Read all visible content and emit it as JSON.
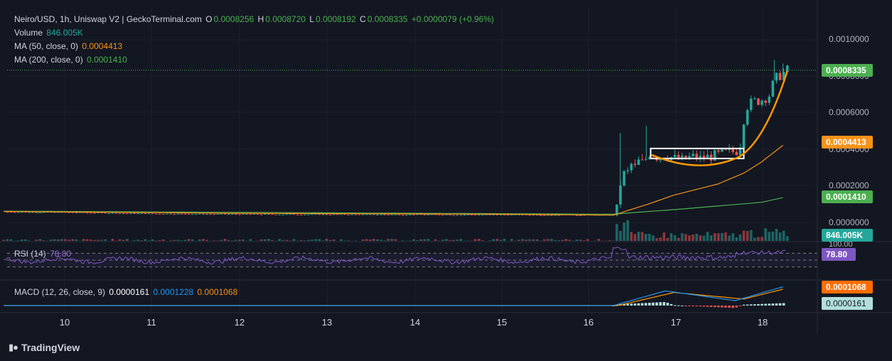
{
  "header": {
    "symbol_line": "Neiro/USD, 1h, Uniswap V2 | GeckoTerminal.com",
    "o_label": "O",
    "o_value": "0.0008256",
    "h_label": "H",
    "h_value": "0.0008720",
    "l_label": "L",
    "l_value": "0.0008192",
    "c_label": "C",
    "c_value": "0.0008335",
    "change": "+0.0000079 (+0.96%)"
  },
  "indicators": {
    "volume_label": "Volume",
    "volume_value": "846.005K",
    "ma50_label": "MA (50, close, 0)",
    "ma50_value": "0.0004413",
    "ma200_label": "MA (200, close, 0)",
    "ma200_value": "0.0001410",
    "rsi_label": "RSI (14)",
    "rsi_value": "78.80",
    "macd_label": "MACD (12, 26, close, 9)",
    "macd_hist": "0.0000161",
    "macd_line": "0.0001228",
    "macd_signal": "0.0001068"
  },
  "price_axis": {
    "ticks": [
      "0.0010000",
      "0.0008000",
      "0.0006000",
      "0.0004000",
      "0.0002000",
      "0.0000000"
    ],
    "last_price_tag": "0.0008335",
    "ma50_tag": "0.0004413",
    "ma200_tag": "0.0001410",
    "volume_tag": "846.005K",
    "rsi_top_tick": "100.00",
    "rsi_tag": "78.80",
    "macd_signal_tag": "0.0001068",
    "macd_hist_tag": "0.0000161"
  },
  "time_axis": [
    "10",
    "11",
    "12",
    "13",
    "14",
    "15",
    "16",
    "17",
    "18"
  ],
  "footer": {
    "brand": "TradingView"
  },
  "colors": {
    "background": "#131722",
    "up": "#26a69a",
    "down": "#ef5350",
    "ma50": "#f7931a",
    "ma200": "#4caf50",
    "rsi": "#7e57c2",
    "macd": "#2196f3",
    "signal": "#ff9800",
    "annotation_curve": "#ff9800",
    "annotation_box": "#ffffff"
  },
  "chart_data": {
    "type": "candlestick",
    "title": "Neiro/USD, 1h, Uniswap V2",
    "x_ticks": [
      "10",
      "11",
      "12",
      "13",
      "14",
      "15",
      "16",
      "17",
      "18"
    ],
    "ylim": [
      0,
      0.001
    ],
    "last_close": 0.0008335,
    "price_path": [
      [
        9.3,
        5.8e-05
      ],
      [
        10.0,
        5.5e-05
      ],
      [
        11.0,
        4.8e-05
      ],
      [
        12.0,
        4.5e-05
      ],
      [
        13.0,
        4.4e-05
      ],
      [
        14.0,
        4.3e-05
      ],
      [
        15.0,
        4.2e-05
      ],
      [
        16.0,
        4.1e-05
      ],
      [
        16.33,
        4e-05
      ],
      [
        16.36,
        0.00012
      ],
      [
        16.4,
        0.00028
      ],
      [
        16.45,
        0.00025
      ],
      [
        16.5,
        0.00032
      ],
      [
        16.55,
        0.0003
      ],
      [
        16.6,
        0.00034
      ],
      [
        16.65,
        0.00032
      ],
      [
        16.7,
        0.00038
      ],
      [
        16.8,
        0.00036
      ],
      [
        16.9,
        0.00037
      ],
      [
        17.0,
        0.00035
      ],
      [
        17.1,
        0.00034
      ],
      [
        17.2,
        0.00036
      ],
      [
        17.3,
        0.00035
      ],
      [
        17.4,
        0.00036
      ],
      [
        17.5,
        0.00037
      ],
      [
        17.6,
        0.00038
      ],
      [
        17.7,
        0.00039
      ],
      [
        17.75,
        0.0004
      ],
      [
        17.78,
        0.0005
      ],
      [
        17.82,
        0.00063
      ],
      [
        17.9,
        0.00066
      ],
      [
        18.0,
        0.00067
      ],
      [
        18.1,
        0.0007
      ],
      [
        18.15,
        0.00078
      ],
      [
        18.2,
        0.0008
      ],
      [
        18.3,
        0.0008335
      ]
    ],
    "ma50": [
      [
        9.3,
        6e-05
      ],
      [
        12.0,
        5e-05
      ],
      [
        15.0,
        4.5e-05
      ],
      [
        16.3,
        4e-05
      ],
      [
        16.7,
        0.0001
      ],
      [
        17.0,
        0.00015
      ],
      [
        17.5,
        0.00021
      ],
      [
        17.8,
        0.00027
      ],
      [
        18.0,
        0.00033
      ],
      [
        18.3,
        0.0004413
      ]
    ],
    "ma200": [
      [
        9.3,
        6.2e-05
      ],
      [
        12.0,
        5.5e-05
      ],
      [
        15.0,
        4.8e-05
      ],
      [
        16.3,
        4.5e-05
      ],
      [
        16.7,
        6e-05
      ],
      [
        17.0,
        7e-05
      ],
      [
        17.5,
        9e-05
      ],
      [
        18.0,
        0.00011
      ],
      [
        18.3,
        0.000141
      ]
    ],
    "rsi": {
      "ylim": [
        0,
        100
      ],
      "last": 78.8
    },
    "macd": {
      "line_last": 0.0001228,
      "signal_last": 0.0001068,
      "hist_last": 1.61e-05
    },
    "volume_last": "846.005K"
  }
}
